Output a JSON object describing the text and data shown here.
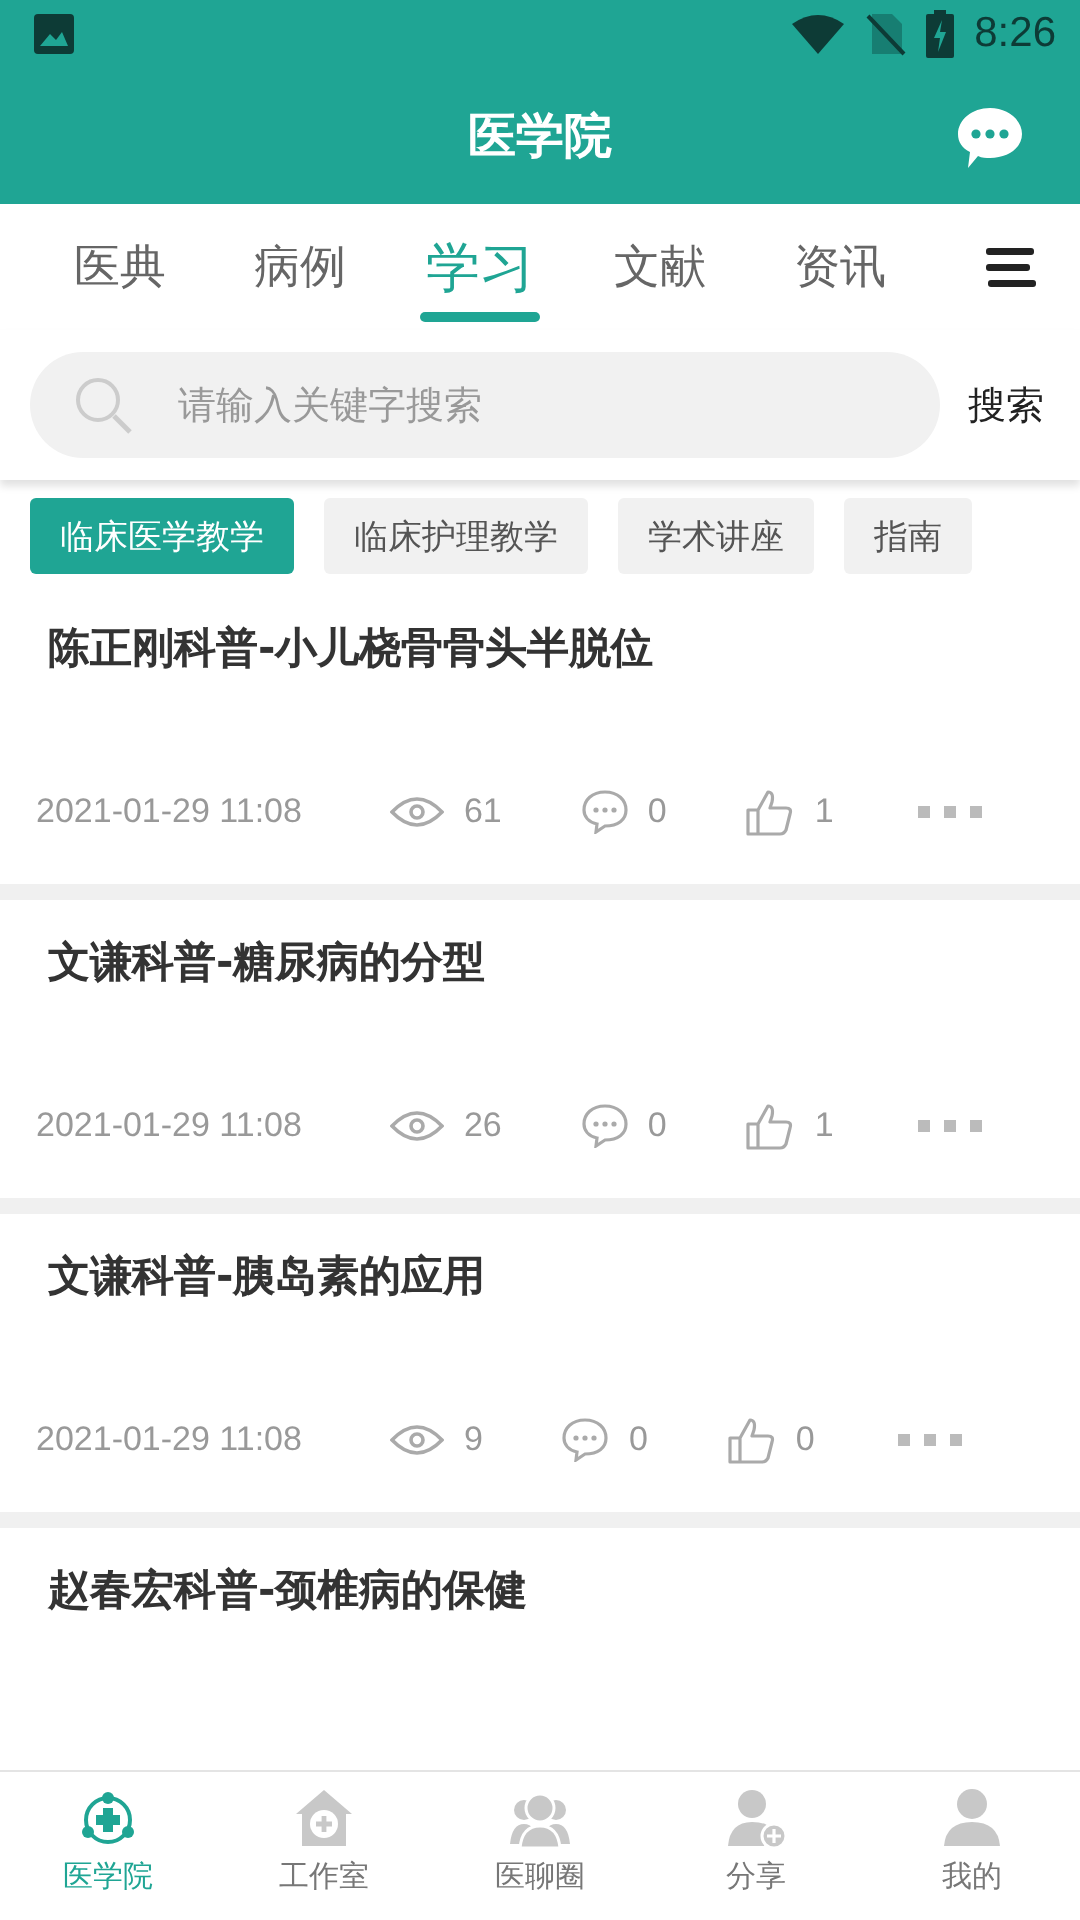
{
  "status_bar": {
    "time": "8:26"
  },
  "header": {
    "title": "医学院"
  },
  "tabs": [
    {
      "label": "医典",
      "selected": false
    },
    {
      "label": "病例",
      "selected": false
    },
    {
      "label": "学习",
      "selected": true
    },
    {
      "label": "文献",
      "selected": false
    },
    {
      "label": "资讯",
      "selected": false
    }
  ],
  "search": {
    "placeholder": "请输入关键字搜索",
    "button": "搜索"
  },
  "categories": [
    {
      "label": "临床医学教学",
      "selected": true
    },
    {
      "label": "临床护理教学",
      "selected": false
    },
    {
      "label": "学术讲座",
      "selected": false
    },
    {
      "label": "指南",
      "selected": false
    }
  ],
  "articles": [
    {
      "title": "陈正刚科普-小儿桡骨骨头半脱位",
      "date": "2021-01-29 11:08",
      "views": "61",
      "comments": "0",
      "likes": "1"
    },
    {
      "title": "文谦科普-糖尿病的分型",
      "date": "2021-01-29 11:08",
      "views": "26",
      "comments": "0",
      "likes": "1"
    },
    {
      "title": "文谦科普-胰岛素的应用",
      "date": "2021-01-29 11:08",
      "views": "9",
      "comments": "0",
      "likes": "0"
    },
    {
      "title": "赵春宏科普-颈椎病的保健"
    }
  ],
  "bottom_nav": [
    {
      "label": "医学院",
      "kind": "academy",
      "selected": true
    },
    {
      "label": "工作室",
      "kind": "studio",
      "selected": false
    },
    {
      "label": "医聊圈",
      "kind": "circle",
      "selected": false
    },
    {
      "label": "分享",
      "kind": "share",
      "selected": false
    },
    {
      "label": "我的",
      "kind": "me",
      "selected": false
    }
  ]
}
